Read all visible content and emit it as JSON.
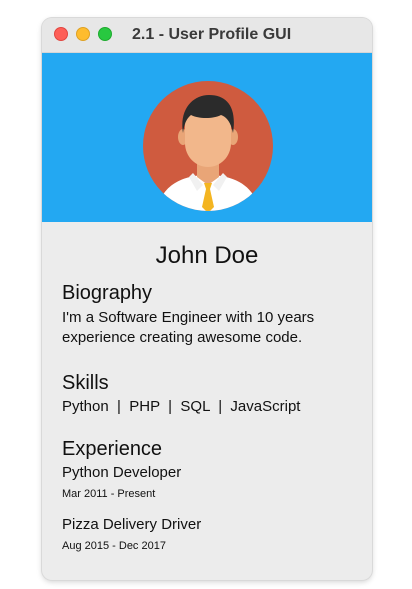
{
  "window": {
    "title": "2.1 - User Profile GUI"
  },
  "header": {
    "avatar_icon": "user-avatar-icon",
    "background_color": "#23a8f2"
  },
  "profile": {
    "name": "John Doe"
  },
  "biography": {
    "heading": "Biography",
    "line1": "I'm a Software Engineer with 10 years",
    "line2": "experience creating awesome code."
  },
  "skills": {
    "heading": "Skills",
    "list": "Python  |  PHP  |  SQL  |  JavaScript"
  },
  "experience": {
    "heading": "Experience",
    "items": [
      {
        "title": "Python Developer",
        "dates": "Mar 2011 - Present"
      },
      {
        "title": "Pizza Delivery Driver",
        "dates": "Aug 2015 - Dec 2017"
      }
    ]
  }
}
